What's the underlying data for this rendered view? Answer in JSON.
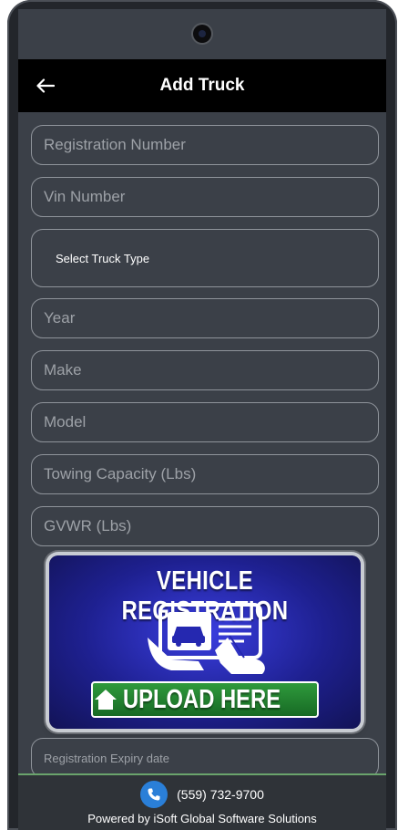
{
  "appbar": {
    "title": "Add Truck",
    "back_icon": "arrow-left-icon"
  },
  "form": {
    "registration_number": {
      "placeholder": "Registration Number",
      "value": ""
    },
    "vin_number": {
      "placeholder": "Vin Number",
      "value": ""
    },
    "truck_type": {
      "label": "Select Truck Type"
    },
    "year": {
      "placeholder": "Year",
      "value": ""
    },
    "make": {
      "placeholder": "Make",
      "value": ""
    },
    "model": {
      "placeholder": "Model",
      "value": ""
    },
    "towing_capacity": {
      "placeholder": "Towing Capacity (Lbs)",
      "value": ""
    },
    "gvwr": {
      "placeholder": "GVWR (Lbs)",
      "value": ""
    },
    "registration_expiry": {
      "placeholder": "Registration Expiry date",
      "value": ""
    }
  },
  "upload_card": {
    "title": "VEHICLE REGISTRATION",
    "button_label": "UPLOAD HERE",
    "button_color": "#1f8a2e",
    "background_color": "#2528b0"
  },
  "footer": {
    "phone": "(559) 732-9700",
    "phone_icon": "phone-icon",
    "powered_by": "Powered by iSoft Global Software Solutions"
  },
  "colors": {
    "screen_background": "#3b4048",
    "appbar_background": "#000000",
    "field_border": "#8f949b",
    "footer_border": "#6aa46c",
    "phone_icon_bg": "#2a7fd8"
  }
}
